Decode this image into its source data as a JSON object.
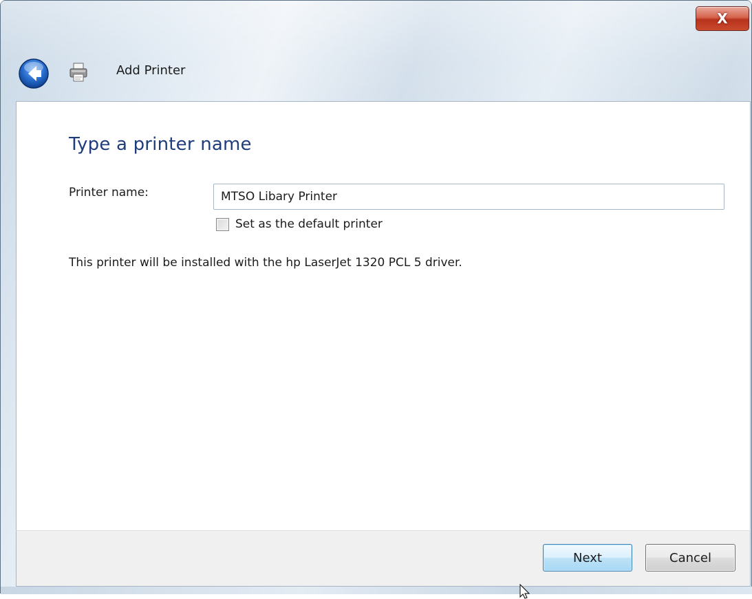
{
  "window": {
    "title": "Add Printer",
    "close_symbol": "X"
  },
  "icons": {
    "back": "back-arrow-icon",
    "printer": "printer-icon",
    "close": "close-icon",
    "cursor": "mouse-cursor-icon"
  },
  "page": {
    "heading": "Type a printer name",
    "printer_name_label": "Printer name:",
    "printer_name_value": "MTSO Libary Printer",
    "default_checkbox_label": "Set as the default printer",
    "default_checked": false,
    "driver_info": "This printer will be installed with the hp LaserJet 1320 PCL 5 driver."
  },
  "footer": {
    "next_label": "Next",
    "cancel_label": "Cancel"
  },
  "colors": {
    "heading": "#1e3d7a",
    "close_button": "#c94a2f",
    "back_button": "#2a6fd0"
  }
}
